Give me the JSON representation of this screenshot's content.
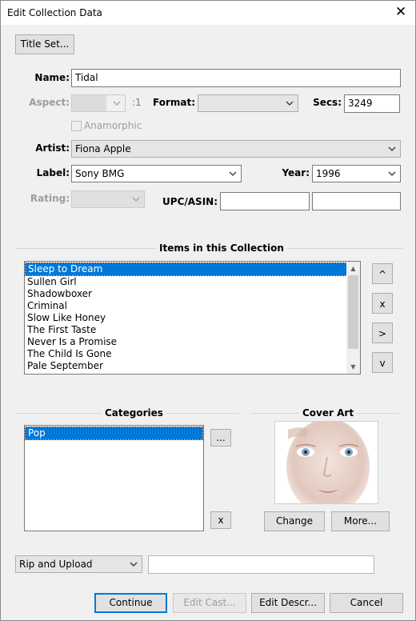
{
  "window": {
    "title": "Edit Collection Data"
  },
  "buttons": {
    "title_set": "Title Set...",
    "move_up": "^",
    "remove_item": "x",
    "move_right": ">",
    "move_down": "v",
    "categories_more": "...",
    "categories_remove": "x",
    "change": "Change",
    "more": "More...",
    "continue": "Continue",
    "edit_cast": "Edit Cast...",
    "edit_descr": "Edit Descr...",
    "cancel": "Cancel"
  },
  "fields": {
    "name_label": "Name:",
    "name_value": "Tidal",
    "aspect_label": "Aspect:",
    "aspect_suffix": ":1",
    "format_label": "Format:",
    "secs_label": "Secs:",
    "secs_value": "3249",
    "anamorphic_label": "Anamorphic",
    "artist_label": "Artist:",
    "artist_value": "Fiona Apple",
    "label_label": "Label:",
    "label_value": "Sony BMG",
    "year_label": "Year:",
    "year_value": "1996",
    "rating_label": "Rating:",
    "upc_label": "UPC/ASIN:"
  },
  "items": {
    "heading": "Items in this Collection",
    "list": [
      "Sleep to Dream",
      "Sullen Girl",
      "Shadowboxer",
      "Criminal",
      "Slow Like Honey",
      "The First Taste",
      "Never Is a Promise",
      "The Child Is Gone",
      "Pale September"
    ],
    "selected_index": 0
  },
  "categories": {
    "heading": "Categories",
    "list": [
      "Pop"
    ],
    "selected_index": 0
  },
  "cover_art": {
    "heading": "Cover Art"
  },
  "bottom": {
    "action_select": "Rip and Upload"
  },
  "colors": {
    "selection": "#0078d7",
    "default_button_border": "#0078d7"
  }
}
